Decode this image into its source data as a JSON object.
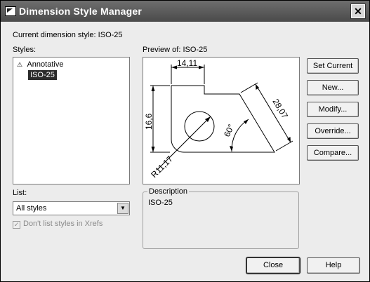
{
  "window": {
    "title": "Dimension Style Manager",
    "close_glyph": "✕"
  },
  "current_style": {
    "label": "Current dimension style:",
    "value": "ISO-25"
  },
  "styles": {
    "label": "Styles:",
    "items": [
      {
        "label": "Annotative",
        "icon": "annotative-triangle-icon",
        "selected": false
      },
      {
        "label": "ISO-25",
        "icon": "",
        "selected": true
      }
    ]
  },
  "list": {
    "label": "List:",
    "selected": "All styles"
  },
  "xrefs_checkbox": {
    "label": "Don't list styles in Xrefs",
    "checked": true,
    "enabled": false
  },
  "preview": {
    "label": "Preview of:",
    "style": "ISO-25",
    "dim_top": "14,11",
    "dim_left": "16,6",
    "dim_diag": "28,07",
    "dim_angle": "60°",
    "dim_radius": "R11,17"
  },
  "description": {
    "legend": "Description",
    "text": "ISO-25"
  },
  "buttons": {
    "set_current": "Set Current",
    "new": "New...",
    "modify": "Modify...",
    "override": "Override...",
    "compare": "Compare...",
    "close": "Close",
    "help": "Help"
  }
}
